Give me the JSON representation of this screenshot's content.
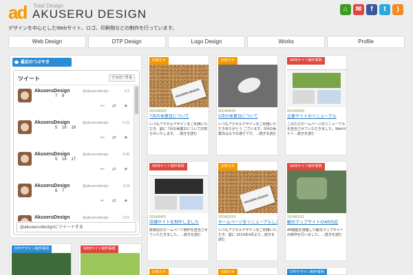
{
  "header": {
    "logo_mark": "ad",
    "logo_small": "Total Design",
    "logo_big": "AKUSERU DESIGN",
    "tagline": "デザインを中心としたWebサイト、ロゴ、印刷物などの制作を行っています。",
    "social": [
      {
        "name": "home-icon",
        "glyph": "⌂",
        "color": "#3a9d23"
      },
      {
        "name": "mail-icon",
        "glyph": "✉",
        "color": "#e0473f"
      },
      {
        "name": "facebook-icon",
        "glyph": "f",
        "color": "#3b5998"
      },
      {
        "name": "twitter-icon",
        "glyph": "t",
        "color": "#2aa9e0"
      },
      {
        "name": "rss-icon",
        "glyph": ")",
        "color": "#f08a24"
      }
    ]
  },
  "nav": [
    "Web Design",
    "DTP Design",
    "Logo Design",
    "Works",
    "Profile"
  ],
  "twitter": {
    "tab_label": "最近のつぶやき",
    "title": "ツイート",
    "follow_label": "フォローする",
    "input_placeholder": "@akuserudesignにツイートする",
    "tweets": [
      {
        "name": "AkuseruDesign",
        "handle": "@akuserudesign",
        "date": "6.2",
        "text": "7 8"
      },
      {
        "name": "AkuseruDesign",
        "handle": "@akuserudesign",
        "date": "5.15",
        "text": "5 16 18"
      },
      {
        "name": "AkuseruDesign",
        "handle": "@akuserudesign",
        "date": "4.30",
        "text": "5 16 17"
      },
      {
        "name": "AkuseruDesign",
        "handle": "@akuserudesign",
        "date": "4.19",
        "text": "6 7"
      },
      {
        "name": "AkuseruDesign",
        "handle": "@akuserudesign",
        "date": "3.31",
        "text": ""
      }
    ]
  },
  "cards": [
    {
      "category": "お知らせ",
      "cat_color": "#f39800",
      "thumb": "cork",
      "date": "2014/06/02",
      "title": "7月の休業日について",
      "excerpt": "いつもアクセルデザインをご利用いただき、誠に 7月の休業日についてお知らせいたします。…続きを読む"
    },
    {
      "category": "お知らせ",
      "cat_color": "#f39800",
      "thumb": "cat",
      "date": "2014/04/30",
      "title": "5月の休業日について",
      "excerpt": "いつもアクセルデザインをご利用いただきありがとう ございます。5月の休業日は以下の通りです。…続きを読む"
    },
    {
      "category": "WEBサイト制作事例",
      "cat_color": "#e0473f",
      "thumb": "web",
      "date": "2014/04/29",
      "title": "企業サイトのリニューアル",
      "excerpt": "このたびホームページのリニューアルを担当させていただきました。Webサイト…続きを読む"
    },
    {
      "category": "WEBサイト制作事例",
      "cat_color": "#e0473f",
      "thumb": "web2",
      "date": "2014/04/01",
      "title": "店舗サイトを制作しました",
      "excerpt": "飲食店のホームページ制作を担当させていただきました。…続きを読む"
    },
    {
      "category": "お知らせ",
      "cat_color": "#f39800",
      "thumb": "cork",
      "date": "2014/02/24",
      "title": "ホームページをリニューアルしました",
      "excerpt": "いつもアクセルデザインをご利用いただき、誠に 2014年4月より…続きを読む"
    },
    {
      "category": "WEBサイト制作事例",
      "cat_color": "#e0473f",
      "thumb": "map",
      "date": "2014/01/31",
      "title": "観光マップサイトのAR対応",
      "excerpt": "AR機能を搭載した観光マップサイトの制作を行いました。…続きを読む"
    }
  ],
  "bottom_cards": [
    {
      "category": "DTPデザイン制作事例",
      "cat_color": "#2a8cd4"
    },
    {
      "category": "WEBサイト制作事例",
      "cat_color": "#e0473f"
    },
    {
      "category": "お知らせ",
      "cat_color": "#f39800"
    },
    {
      "category": "お知らせ",
      "cat_color": "#f39800"
    },
    {
      "category": "DTPデザイン制作事例",
      "cat_color": "#2a8cd4"
    }
  ]
}
